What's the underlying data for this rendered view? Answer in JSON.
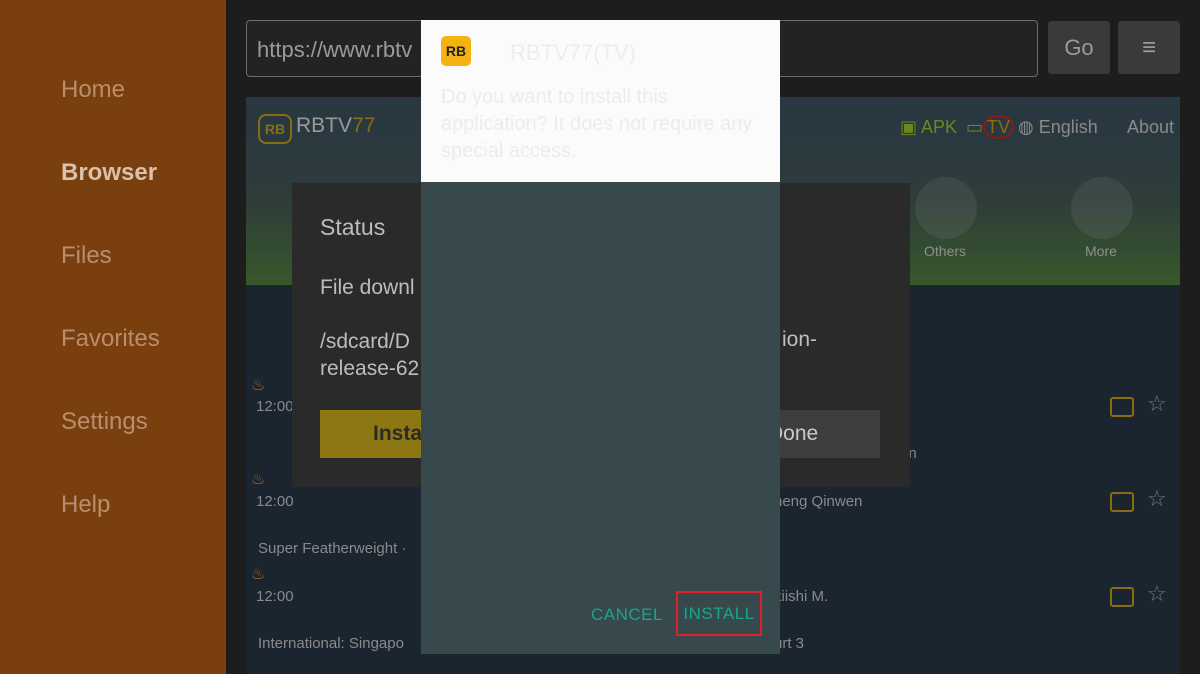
{
  "sidebar": {
    "items": [
      {
        "label": "Home"
      },
      {
        "label": "Browser"
      },
      {
        "label": "Files"
      },
      {
        "label": "Favorites"
      },
      {
        "label": "Settings"
      },
      {
        "label": "Help"
      }
    ]
  },
  "topbar": {
    "url": "https://www.rbtv",
    "go_label": "Go",
    "menu_icon": "≡"
  },
  "webpage": {
    "logo": "RB",
    "brand_main": "RBTV",
    "brand_num": "77",
    "nav": {
      "apk": "APK",
      "tv": "TV",
      "english": "English",
      "about": "About"
    },
    "categories": [
      {
        "label": "Others"
      },
      {
        "label": "More"
      }
    ],
    "rows": [
      {
        "time": "12:00",
        "right": ""
      },
      {
        "time": "12:00",
        "right": "heng Qinwen"
      },
      {
        "time": "12:00",
        "right": "kiishi M."
      }
    ],
    "league_texts": [
      {
        "text": "en"
      },
      {
        "text": "Super Featherweight ·"
      },
      {
        "text": "International: Singapo"
      },
      {
        "text": "urt 3"
      }
    ]
  },
  "status_dialog": {
    "title": "Status",
    "message": "File downl",
    "path_line1": "/sdcard/D",
    "path_line2": "release-62",
    "path_suffix": "ion-",
    "install_label": "Insta",
    "done_label": "Done"
  },
  "install_dialog": {
    "icon_text": "RB",
    "app_name": "RBTV77(TV)",
    "question": "Do you want to install this application? It does not require any special access.",
    "cancel_label": "CANCEL",
    "install_label": "INSTALL"
  },
  "colors": {
    "sidebar_bg": "#7a3f0f",
    "accent_teal": "#14a888",
    "highlight_red": "#e0202a",
    "app_icon_yellow": "#f5b312"
  }
}
